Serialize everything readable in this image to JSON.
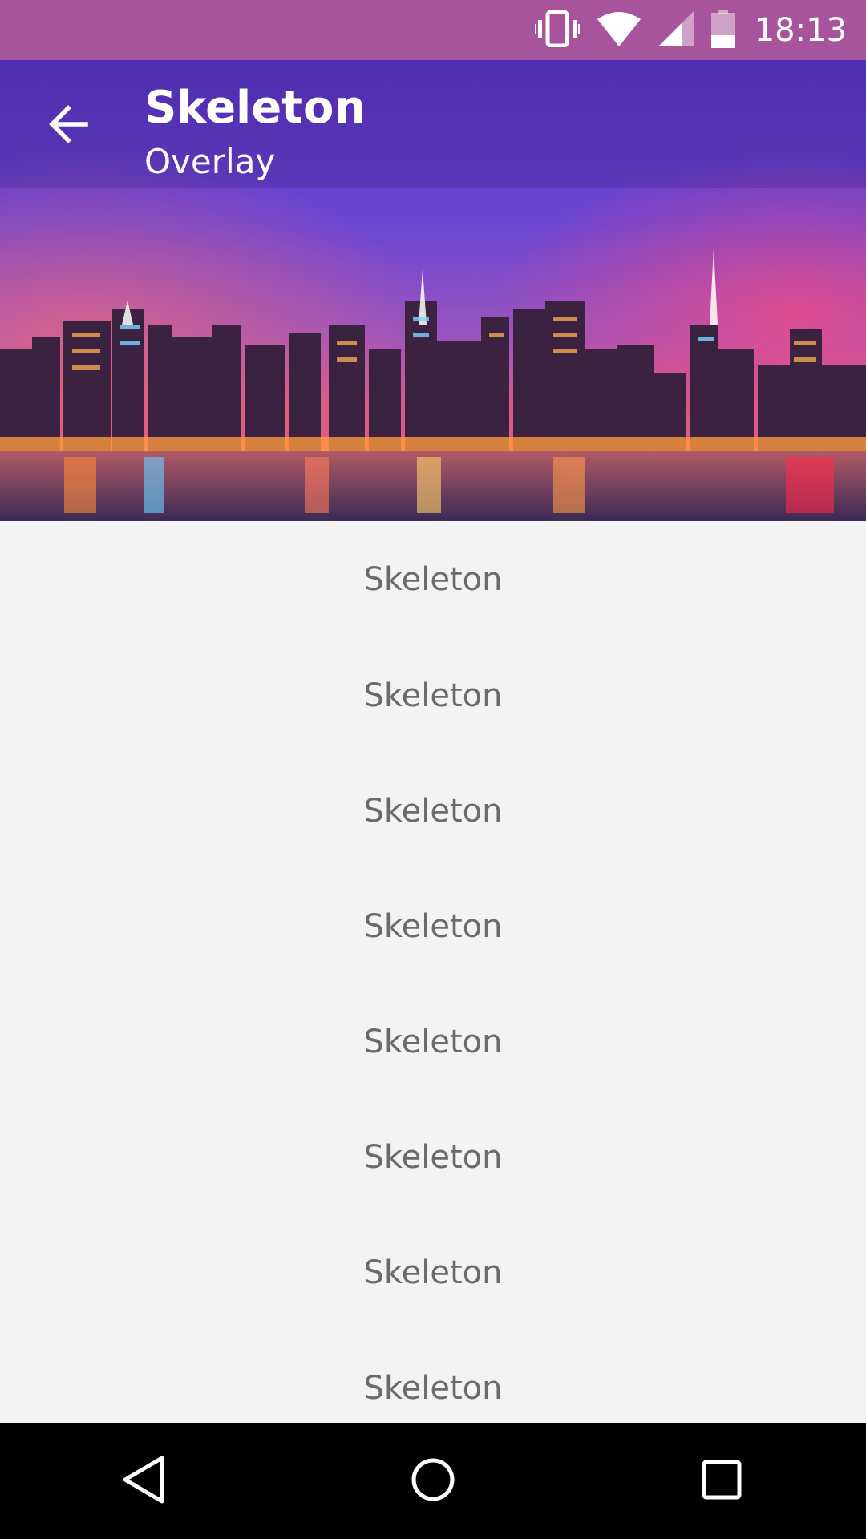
{
  "status_bar": {
    "time": "18:13",
    "icons": [
      "vibrate-icon",
      "wifi-icon",
      "cell-signal-icon",
      "battery-icon"
    ],
    "color": "#a8549c"
  },
  "toolbar": {
    "back_icon": "arrow-back-icon",
    "title": "Skeleton",
    "subtitle": "Overlay"
  },
  "list": {
    "items": [
      "Skeleton",
      "Skeleton",
      "Skeleton",
      "Skeleton",
      "Skeleton",
      "Skeleton",
      "Skeleton",
      "Skeleton"
    ]
  },
  "nav_bar": {
    "icons": [
      "back-triangle-icon",
      "home-circle-icon",
      "recents-square-icon"
    ]
  }
}
